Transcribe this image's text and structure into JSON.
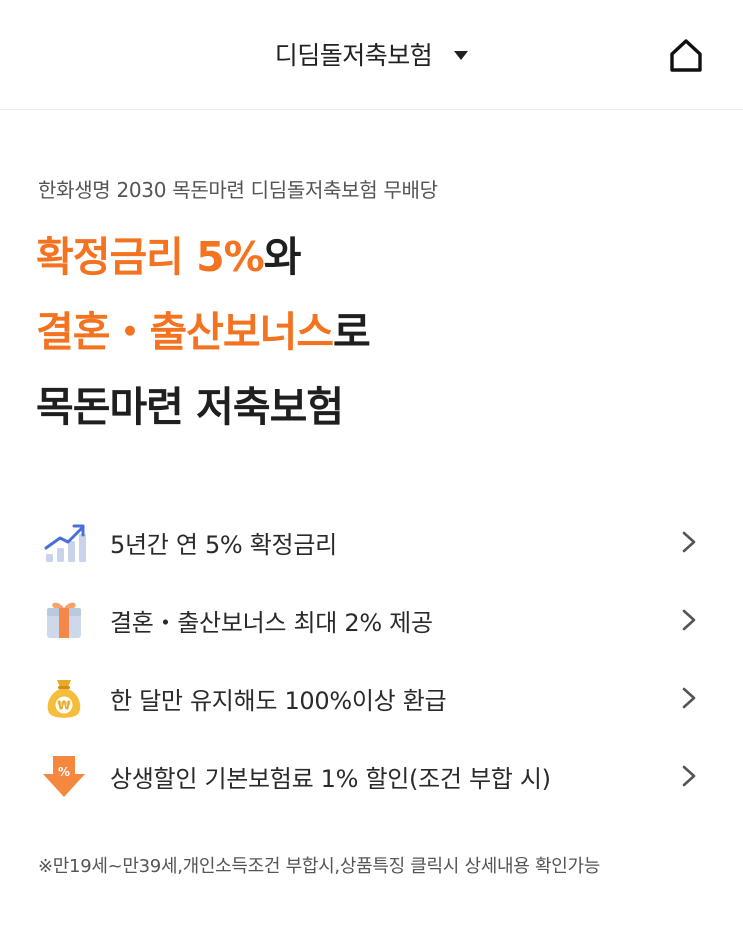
{
  "header": {
    "title": "디딤돌저축보험",
    "caret_icon": "caret-down-icon",
    "home_icon": "home-icon"
  },
  "intro": {
    "product_name": "한화생명 2030 목돈마련 디딤돌저축보험 무배당",
    "headline": {
      "line1_highlight": "확정금리 5%",
      "line1_rest": "와",
      "line2_highlight": "결혼・출산보너스",
      "line2_rest": "로",
      "line3": "목돈마련 저축보험"
    }
  },
  "features": [
    {
      "label": "5년간 연 5% 확정금리",
      "icon": "rising-chart-icon"
    },
    {
      "label": "결혼・출산보너스 최대 2% 제공",
      "icon": "gift-icon"
    },
    {
      "label": "한 달만 유지해도 100%이상 환급",
      "icon": "money-bag-icon"
    },
    {
      "label": "상생할인 기본보험료 1% 할인(조건 부합 시)",
      "icon": "discount-arrow-icon"
    }
  ],
  "note": "※만19세~만39세,개인소득조건 부합시,상품특징 클릭시 상세내용 확인가능",
  "colors": {
    "accent": "#f37321",
    "text": "#222222",
    "muted": "#555555"
  }
}
